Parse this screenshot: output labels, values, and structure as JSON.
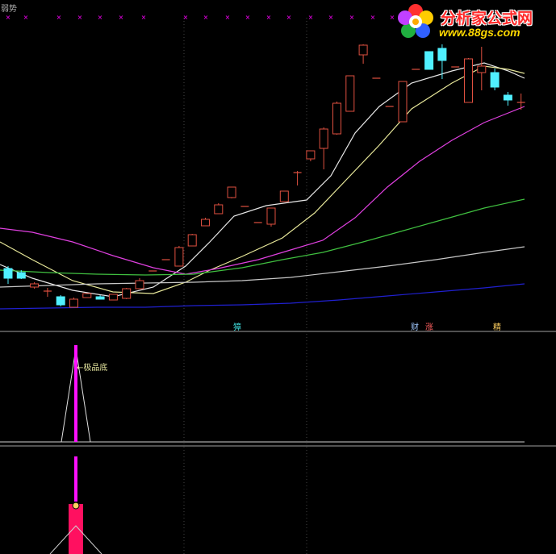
{
  "header": {
    "top_left_label": "弱势"
  },
  "brand": {
    "title": "分析家公式网",
    "url": "www.88gs.com",
    "logo_icon": "flower-logo-icon"
  },
  "colors": {
    "background": "#000000",
    "candle_up": "#e05040",
    "candle_down": "#50f0ff",
    "ma_white": "#e8e8e8",
    "ma_yellow": "#e8e89a",
    "ma_magenta": "#e040e0",
    "ma_green": "#40c040",
    "ma_gray": "#c8c8c8",
    "ma_blue": "#2020d0",
    "signal_magenta": "#ff10ff",
    "signal_red": "#ff1060",
    "marker_pink": "#ff00ff"
  },
  "chart_data": [
    {
      "type": "candlestick",
      "panel": "main",
      "title": "",
      "grid": "dotted vertical",
      "candles": [
        {
          "o": 333,
          "h": 330,
          "l": 352,
          "c": 345
        },
        {
          "o": 338,
          "h": 335,
          "l": 346,
          "c": 345
        },
        {
          "o": 356,
          "h": 350,
          "l": 358,
          "c": 352
        },
        {
          "o": 361,
          "h": 357,
          "l": 368,
          "c": 361
        },
        {
          "o": 368,
          "h": 366,
          "l": 380,
          "c": 378
        },
        {
          "o": 381,
          "h": 369,
          "l": 381,
          "c": 371
        },
        {
          "o": 369,
          "h": 364,
          "l": 369,
          "c": 364
        },
        {
          "o": 368,
          "h": 366,
          "l": 371,
          "c": 371
        },
        {
          "o": 372,
          "h": 365,
          "l": 372,
          "c": 365
        },
        {
          "o": 370,
          "h": 357,
          "l": 371,
          "c": 358
        },
        {
          "o": 358,
          "h": 345,
          "l": 358,
          "c": 348
        },
        {
          "o": 336,
          "h": 336,
          "l": 336,
          "c": 336
        },
        {
          "o": 322,
          "h": 322,
          "l": 322,
          "c": 322
        },
        {
          "o": 330,
          "h": 305,
          "l": 330,
          "c": 307
        },
        {
          "o": 305,
          "h": 290,
          "l": 305,
          "c": 291
        },
        {
          "o": 280,
          "h": 270,
          "l": 280,
          "c": 272
        },
        {
          "o": 265,
          "h": 252,
          "l": 265,
          "c": 254
        },
        {
          "o": 245,
          "h": 232,
          "l": 246,
          "c": 232
        },
        {
          "o": 256,
          "h": 256,
          "l": 256,
          "c": 256
        },
        {
          "o": 276,
          "h": 276,
          "l": 276,
          "c": 276
        },
        {
          "o": 278,
          "h": 258,
          "l": 281,
          "c": 258
        },
        {
          "o": 250,
          "h": 237,
          "l": 250,
          "c": 237
        },
        {
          "o": 214,
          "h": 212,
          "l": 230,
          "c": 214
        },
        {
          "o": 197,
          "h": 187,
          "l": 200,
          "c": 187
        },
        {
          "o": 184,
          "h": 158,
          "l": 210,
          "c": 160
        },
        {
          "o": 166,
          "h": 126,
          "l": 167,
          "c": 128
        },
        {
          "o": 138,
          "h": 94,
          "l": 138,
          "c": 94
        },
        {
          "o": 68,
          "h": 55,
          "l": 79,
          "c": 56
        },
        {
          "o": 97,
          "h": 97,
          "l": 97,
          "c": 97
        },
        {
          "o": 132,
          "h": 132,
          "l": 132,
          "c": 132
        },
        {
          "o": 151,
          "h": 101,
          "l": 151,
          "c": 101
        },
        {
          "o": 86,
          "h": 86,
          "l": 86,
          "c": 86
        },
        {
          "o": 64,
          "h": 64,
          "l": 86,
          "c": 86
        },
        {
          "o": 60,
          "h": 55,
          "l": 98,
          "c": 75
        },
        {
          "o": 83,
          "h": 83,
          "l": 83,
          "c": 83
        },
        {
          "o": 127,
          "h": 72,
          "l": 127,
          "c": 73
        },
        {
          "o": 90,
          "h": 58,
          "l": 112,
          "c": 82
        },
        {
          "o": 90,
          "h": 85,
          "l": 112,
          "c": 108
        },
        {
          "o": 118,
          "h": 114,
          "l": 131,
          "c": 124
        },
        {
          "o": 127,
          "h": 116,
          "l": 136,
          "c": 127
        }
      ],
      "labels": [
        {
          "text": "獐",
          "color": "#40e0e0"
        },
        {
          "text": "财",
          "color": "#a0c8ff"
        },
        {
          "text": "涨",
          "color": "#ff6060"
        },
        {
          "text": "精",
          "color": "#ffd060"
        }
      ]
    },
    {
      "type": "line",
      "panel": "indicator",
      "annotation": "极品底"
    },
    {
      "type": "bar",
      "panel": "signal"
    }
  ]
}
